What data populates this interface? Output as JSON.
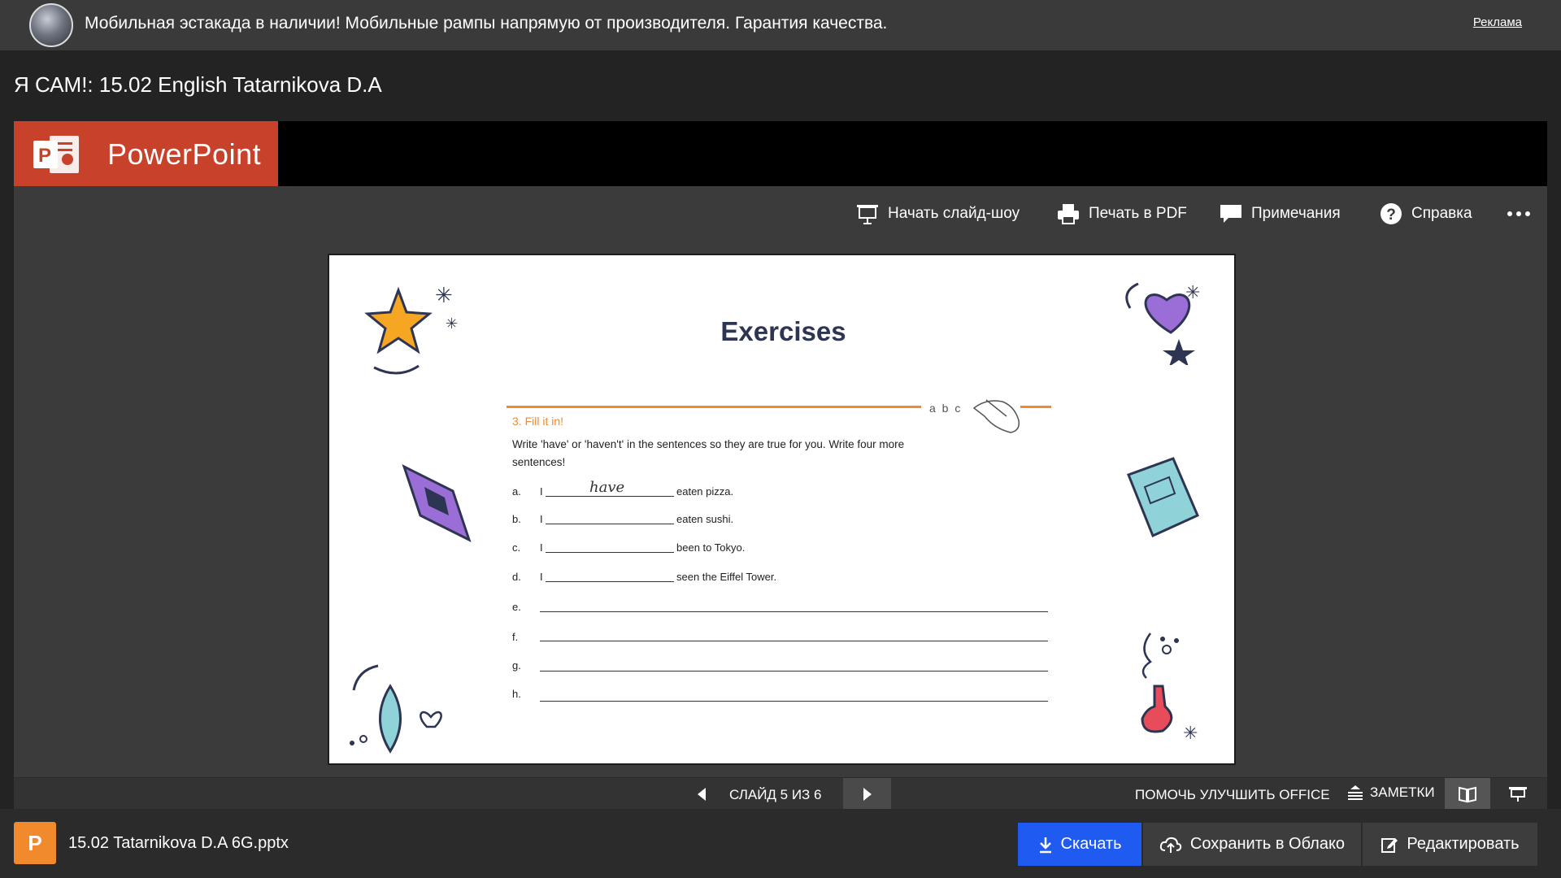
{
  "ad": {
    "text": "Мобильная эстакада в наличии!  Мобильные рампы напрямую от производителя. Гарантия качества.",
    "label": "Реклама"
  },
  "page": {
    "title": "Я САМ!: 15.02 English Tatarnikova D.A"
  },
  "app": {
    "name": "PowerPoint",
    "accent": "#c8412a"
  },
  "toolbar": {
    "slideshow": "Начать слайд-шоу",
    "print_pdf": "Печать в PDF",
    "comments": "Примечания",
    "help": "Справка"
  },
  "slide": {
    "title": "Exercises",
    "decor_text": "a b c",
    "exercise_heading": "3. Fill it in!",
    "instruction": "Write 'have' or 'haven't' in the sentences so they are true for you. Write four more sentences!",
    "rows": [
      {
        "letter": "a.",
        "subject": "I",
        "answer": "have",
        "ending": "eaten pizza."
      },
      {
        "letter": "b.",
        "subject": "I",
        "answer": "",
        "ending": "eaten sushi."
      },
      {
        "letter": "c.",
        "subject": "I",
        "answer": "",
        "ending": "been to Tokyo."
      },
      {
        "letter": "d.",
        "subject": "I",
        "answer": "",
        "ending": "seen the Eiffel Tower."
      }
    ],
    "blank_rows": [
      "e.",
      "f.",
      "g.",
      "h."
    ]
  },
  "statusbar": {
    "counter": "СЛАЙД 5 ИЗ 6",
    "help_improve": "ПОМОЧЬ УЛУЧШИТЬ OFFICE",
    "notes": "ЗАМЕТКИ"
  },
  "bottom": {
    "file_name": "15.02 Tatarnikova D.A 6G.pptx",
    "file_letter": "P",
    "download": "Скачать",
    "save_cloud": "Сохранить в Облако",
    "edit": "Редактировать",
    "download_color": "#1f5bf0"
  }
}
